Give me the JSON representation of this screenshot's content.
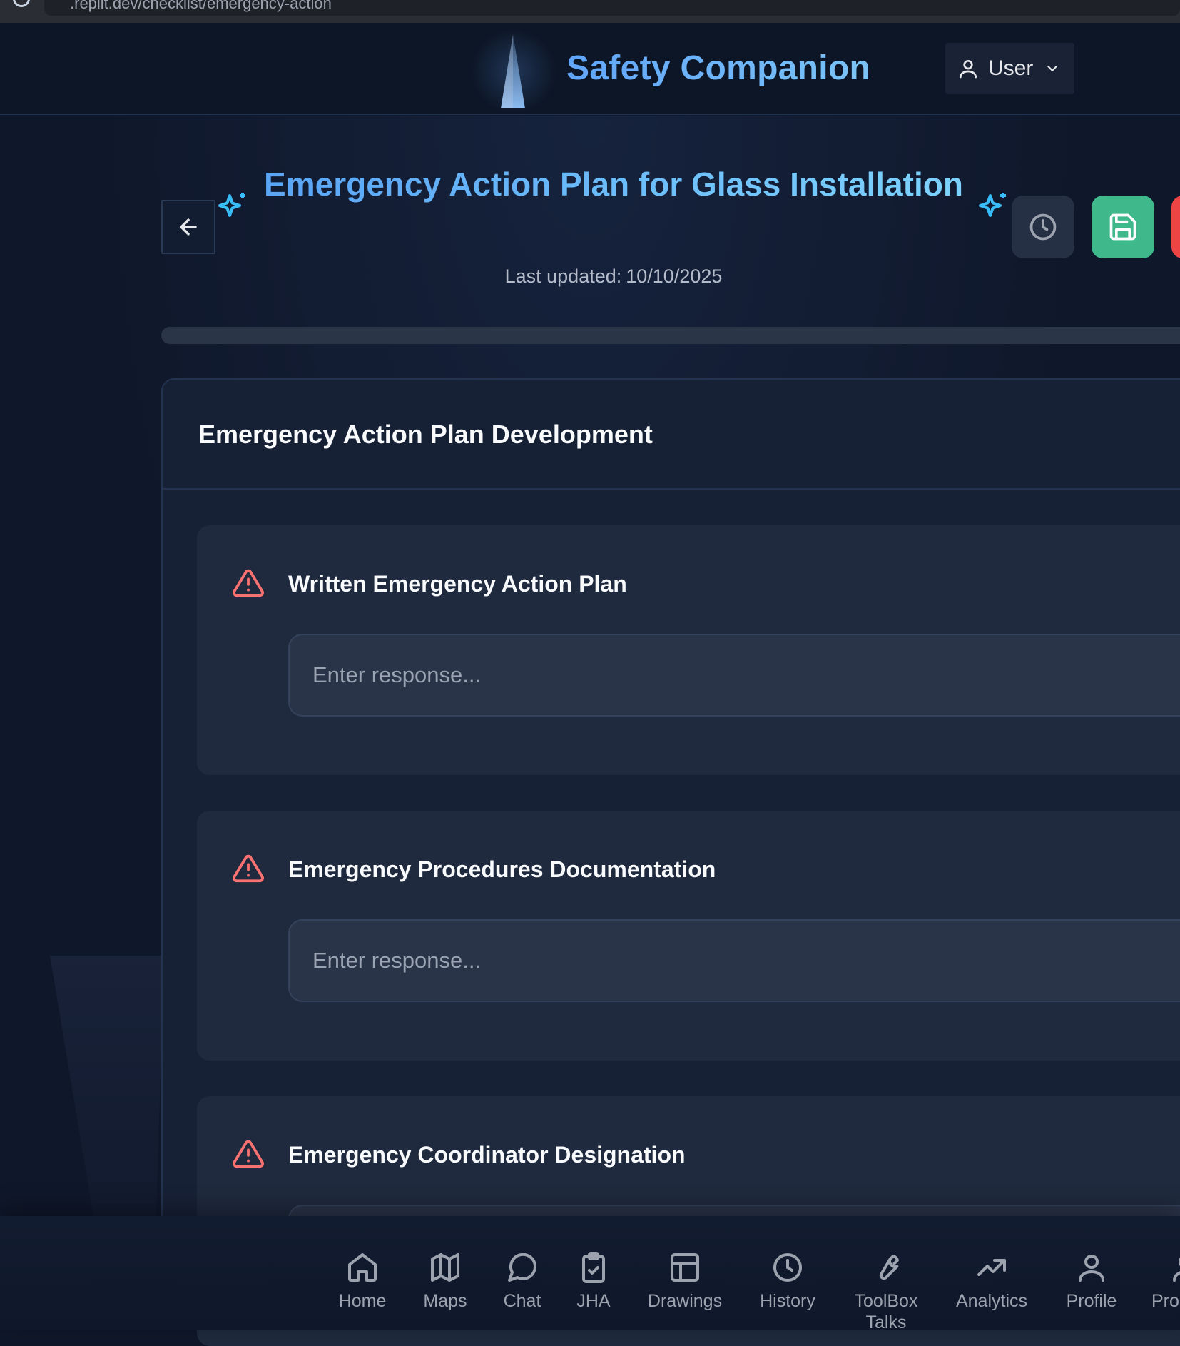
{
  "browser": {
    "url": ".replit.dev/checklist/emergency-action"
  },
  "header": {
    "brand": "Safety Companion",
    "user_label": "User"
  },
  "page": {
    "title": "Emergency Action Plan for Glass Installation",
    "last_updated_label": "Last updated:",
    "last_updated_value": "10/10/2025",
    "progress_percent": 0
  },
  "section": {
    "title": "Emergency Action Plan Development",
    "items": [
      {
        "label": "Written Emergency Action Plan",
        "placeholder": "Enter response..."
      },
      {
        "label": "Emergency Procedures Documentation",
        "placeholder": "Enter response..."
      },
      {
        "label": "Emergency Coordinator Designation",
        "placeholder": "Enter response..."
      }
    ]
  },
  "nav": {
    "items": [
      {
        "label": "Home",
        "icon": "home-icon"
      },
      {
        "label": "Maps",
        "icon": "map-icon"
      },
      {
        "label": "Chat",
        "icon": "chat-icon"
      },
      {
        "label": "JHA",
        "icon": "clipboard-check-icon"
      },
      {
        "label": "Drawings",
        "icon": "layout-icon"
      },
      {
        "label": "History",
        "icon": "clock-icon"
      },
      {
        "label": "ToolBox Talks",
        "icon": "wrench-icon"
      },
      {
        "label": "Analytics",
        "icon": "trending-up-icon"
      },
      {
        "label": "Profile",
        "icon": "user-icon"
      },
      {
        "label": "Pro",
        "icon": "user-icon"
      }
    ]
  },
  "colors": {
    "accent": "#60a5fa",
    "save": "#3fb98b",
    "danger": "#ef4444",
    "warning_icon": "#f87171",
    "sparkle": "#38bdf8"
  }
}
